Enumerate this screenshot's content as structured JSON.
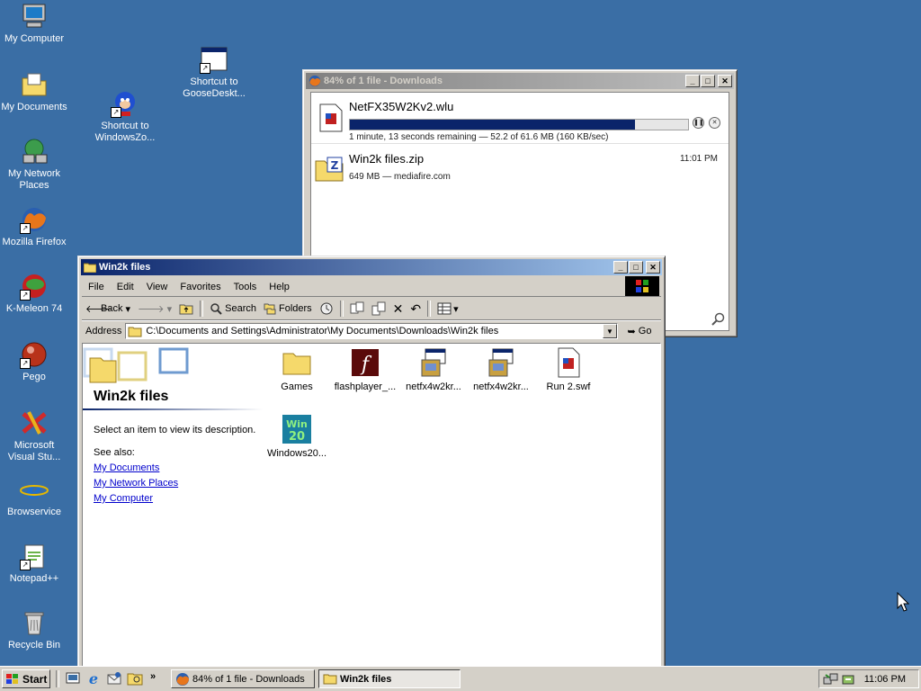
{
  "desktop": {
    "icons": [
      {
        "label": "My Computer",
        "icon": "computer-icon"
      },
      {
        "label": "My Documents",
        "icon": "documents-folder-icon"
      },
      {
        "label": "My Network Places",
        "icon": "network-icon"
      },
      {
        "label": "Mozilla Firefox",
        "icon": "firefox-icon"
      },
      {
        "label": "K-Meleon 74",
        "icon": "kmeleon-icon"
      },
      {
        "label": "Pego",
        "icon": "pego-icon"
      },
      {
        "label": "Microsoft Visual Stu...",
        "icon": "visual-studio-icon"
      },
      {
        "label": "Browservice",
        "icon": "ie-icon"
      },
      {
        "label": "Notepad++",
        "icon": "notepadpp-icon"
      },
      {
        "label": "Recycle Bin",
        "icon": "recycle-bin-icon"
      },
      {
        "label": "Shortcut to WindowsZo...",
        "icon": "sonic-icon"
      },
      {
        "label": "Shortcut to GooseDeskt...",
        "icon": "app-window-icon"
      }
    ]
  },
  "downloads_window": {
    "title": "84% of 1 file - Downloads",
    "items": [
      {
        "filename": "NetFX35W2Kv2.wlu",
        "progress_fraction": 0.844,
        "status": "1 minute, 13 seconds remaining — 52.2 of 61.6 MB (160 KB/sec)"
      },
      {
        "filename": "Win2k files.zip",
        "info": "649 MB — mediafire.com",
        "time": "11:01 PM"
      }
    ]
  },
  "explorer_window": {
    "title": "Win2k files",
    "menu": [
      "File",
      "Edit",
      "View",
      "Favorites",
      "Tools",
      "Help"
    ],
    "toolbar": {
      "back": "Back",
      "search": "Search",
      "folders": "Folders"
    },
    "address_label": "Address",
    "address_value": "C:\\Documents and Settings\\Administrator\\My Documents\\Downloads\\Win2k files",
    "go_label": "Go",
    "left_pane": {
      "folder_title": "Win2k files",
      "description": "Select an item to view its description.",
      "see_also": "See also:",
      "links": [
        "My Documents",
        "My Network Places",
        "My Computer"
      ]
    },
    "files": [
      {
        "name": "Games",
        "icon": "folder-icon"
      },
      {
        "name": "flashplayer_...",
        "icon": "flash-icon"
      },
      {
        "name": "netfx4w2kr...",
        "icon": "installer-icon"
      },
      {
        "name": "netfx4w2kr...",
        "icon": "installer-icon"
      },
      {
        "name": "Run 2.swf",
        "icon": "swf-file-icon"
      },
      {
        "name": "Windows20...",
        "icon": "win2000-image-icon"
      }
    ]
  },
  "taskbar": {
    "start_label": "Start",
    "buttons": [
      {
        "label": "84% of 1 file - Downloads"
      },
      {
        "label": "Win2k files"
      }
    ],
    "clock": "11:06 PM"
  }
}
